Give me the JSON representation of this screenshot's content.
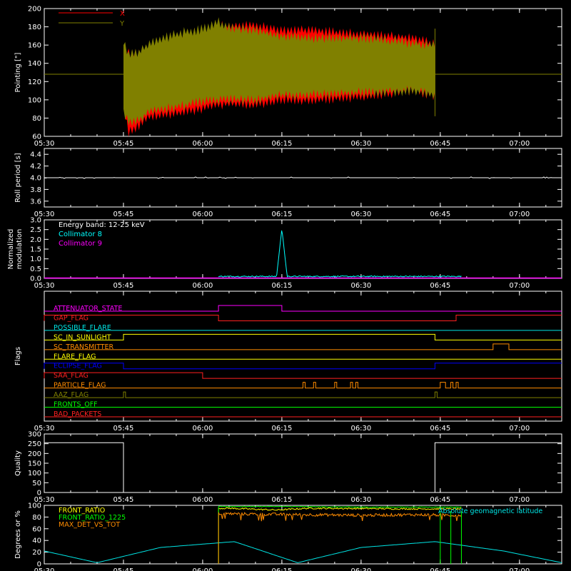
{
  "time_axis": {
    "tick_labels": [
      "05:30",
      "05:45",
      "06:00",
      "06:15",
      "06:30",
      "06:45",
      "07:00"
    ],
    "tick_minutes": [
      330,
      345,
      360,
      375,
      390,
      405,
      420
    ],
    "range_minutes": [
      330,
      428
    ]
  },
  "chart_data": [
    {
      "id": "pointing",
      "type": "area",
      "title": "",
      "ylabel": "Pointing [\"]",
      "ylim": [
        60,
        200
      ],
      "yticks": [
        "60",
        "80",
        "100",
        "120",
        "140",
        "160",
        "180",
        "200"
      ],
      "ytick_values": [
        60,
        80,
        100,
        120,
        140,
        160,
        180,
        200
      ],
      "legend": [
        {
          "name": "X",
          "color": "#ff0000"
        },
        {
          "name": "Y",
          "color": "#808000"
        }
      ],
      "baseline": 128,
      "active_range": [
        "05:45",
        "06:44"
      ],
      "x": [
        "05:45",
        "05:46",
        "05:48",
        "05:50",
        "05:55",
        "06:00",
        "06:03",
        "06:05",
        "06:10",
        "06:15",
        "06:20",
        "06:30",
        "06:40",
        "06:44"
      ],
      "series": [
        {
          "name": "X",
          "color": "#ff0000",
          "upper": [
            162,
            150,
            150,
            160,
            170,
            175,
            180,
            182,
            181,
            176,
            176,
            172,
            168,
            160
          ],
          "lower": [
            90,
            65,
            72,
            82,
            85,
            90,
            95,
            95,
            95,
            100,
            100,
            103,
            110,
            105
          ]
        },
        {
          "name": "Y",
          "color": "#808000",
          "upper": [
            165,
            150,
            152,
            162,
            172,
            178,
            185,
            180,
            176,
            170,
            168,
            168,
            162,
            160
          ],
          "lower": [
            85,
            75,
            78,
            88,
            92,
            98,
            100,
            100,
            100,
            105,
            105,
            108,
            110,
            105
          ]
        }
      ]
    },
    {
      "id": "roll-period",
      "type": "line",
      "ylabel": "Roll period [s]",
      "ylim": [
        3.5,
        4.5
      ],
      "yticks": [
        "3.6",
        "3.8",
        "4.0",
        "4.2",
        "4.4"
      ],
      "ytick_values": [
        3.6,
        3.8,
        4.0,
        4.2,
        4.4
      ],
      "series": [
        {
          "name": "",
          "color": "#ffffff",
          "constant": 4.0
        }
      ]
    },
    {
      "id": "modulation",
      "type": "line",
      "ylabel": "Normalized modulation",
      "ylim": [
        0,
        3
      ],
      "yticks": [
        "0.0",
        "0.5",
        "1.0",
        "1.5",
        "2.0",
        "2.5",
        "3.0"
      ],
      "ytick_values": [
        0,
        0.5,
        1.0,
        1.5,
        2.0,
        2.5,
        3.0
      ],
      "annotation": "Energy band: 12-25 keV",
      "series": [
        {
          "name": "Collimator 8",
          "color": "#00ffff",
          "x": [
            "06:03",
            "06:14",
            "06:15",
            "06:16",
            "06:49"
          ],
          "values": [
            0.1,
            0.1,
            2.55,
            0.1,
            0.1
          ]
        },
        {
          "name": "Collimator 9",
          "color": "#ff00ff",
          "x": [
            "05:30",
            "07:08"
          ],
          "values": [
            0.0,
            0.0
          ]
        }
      ]
    },
    {
      "id": "flags",
      "type": "line",
      "ylabel": "Flags",
      "flags": [
        {
          "name": "ATTENUATOR_STATE",
          "color": "#ff00ff",
          "high": [
            [
              "06:03",
              "06:15"
            ]
          ]
        },
        {
          "name": "GAP_FLAG",
          "color": "#ff2020",
          "high": [
            [
              "05:30",
              "06:03"
            ],
            [
              "06:48",
              "07:08"
            ]
          ]
        },
        {
          "name": "POSSIBLE_FLARE",
          "color": "#00e5e5",
          "high": []
        },
        {
          "name": "SC_IN_SUNLIGHT",
          "color": "#ffff00",
          "high": [
            [
              "05:45",
              "06:44"
            ]
          ]
        },
        {
          "name": "SC_TRANSMITTER",
          "color": "#ff8c00",
          "high": [
            [
              "06:55",
              "06:58"
            ]
          ]
        },
        {
          "name": "FLARE_FLAG",
          "color": "#ffff00",
          "high": []
        },
        {
          "name": "ECLIPSE_FLAG",
          "color": "#0000ff",
          "high": [
            [
              "05:30",
              "05:45"
            ],
            [
              "06:44",
              "07:08"
            ]
          ]
        },
        {
          "name": "SAA_FLAG",
          "color": "#ff2020",
          "high": [
            [
              "05:30",
              "06:00"
            ]
          ]
        },
        {
          "name": "PARTICLE_FLAG",
          "color": "#ff8c00",
          "high": [
            [
              "06:19",
              "06:19"
            ],
            [
              "06:21",
              "06:21"
            ],
            [
              "06:25",
              "06:25"
            ],
            [
              "06:28",
              "06:28"
            ],
            [
              "06:29",
              "06:29"
            ],
            [
              "06:45",
              "06:46"
            ],
            [
              "06:47",
              "06:47"
            ],
            [
              "06:48",
              "06:48"
            ]
          ]
        },
        {
          "name": "AAZ_FLAG",
          "color": "#808000",
          "high": [
            [
              "05:45",
              "05:45"
            ],
            [
              "06:44",
              "06:44"
            ]
          ]
        },
        {
          "name": "FRONTS_OFF",
          "color": "#00ff00",
          "high": []
        },
        {
          "name": "BAD_PACKETS",
          "color": "#ff2020",
          "high": []
        }
      ]
    },
    {
      "id": "quality",
      "type": "line",
      "ylabel": "Quality",
      "ylim": [
        0,
        300
      ],
      "yticks": [
        "0",
        "50",
        "100",
        "150",
        "200",
        "250",
        "300"
      ],
      "ytick_values": [
        0,
        50,
        100,
        150,
        200,
        250,
        300
      ],
      "series": [
        {
          "name": "",
          "color": "#ffffff",
          "x": [
            "05:30",
            "05:45",
            "05:45",
            "06:44",
            "06:44",
            "07:08"
          ],
          "values": [
            255,
            255,
            0,
            0,
            255,
            255
          ]
        }
      ]
    },
    {
      "id": "ratios",
      "type": "line",
      "ylabel": "Degrees or %",
      "ylim": [
        0,
        100
      ],
      "yticks": [
        "0",
        "20",
        "40",
        "60",
        "80",
        "100"
      ],
      "ytick_values": [
        0,
        20,
        40,
        60,
        80,
        100
      ],
      "legend_annotation": "Absolute geomagnetic latitude",
      "series": [
        {
          "name": "FRONT_RATIO",
          "color": "#ffff00",
          "x": [
            "06:03",
            "06:05",
            "06:14",
            "06:20",
            "06:40",
            "06:49"
          ],
          "values": [
            95,
            95,
            92,
            95,
            94,
            94
          ]
        },
        {
          "name": "FRONT_RATIO_1225",
          "color": "#00ff00",
          "x": [
            "06:03",
            "06:15",
            "06:30",
            "06:49"
          ],
          "values": [
            98,
            98,
            97,
            97
          ]
        },
        {
          "name": "MAX_DET_VS_TOT",
          "color": "#ff8c00",
          "x": [
            "06:03",
            "06:10",
            "06:20",
            "06:30",
            "06:40",
            "06:49"
          ],
          "values": [
            86,
            85,
            84,
            83,
            84,
            83
          ]
        },
        {
          "name": "Absolute geomagnetic latitude",
          "color": "#00e5e5",
          "x": [
            "05:30",
            "05:40",
            "05:52",
            "06:06",
            "06:18",
            "06:30",
            "06:44",
            "06:57",
            "07:08"
          ],
          "values": [
            22,
            2,
            28,
            38,
            2,
            28,
            38,
            22,
            2
          ]
        }
      ]
    }
  ]
}
